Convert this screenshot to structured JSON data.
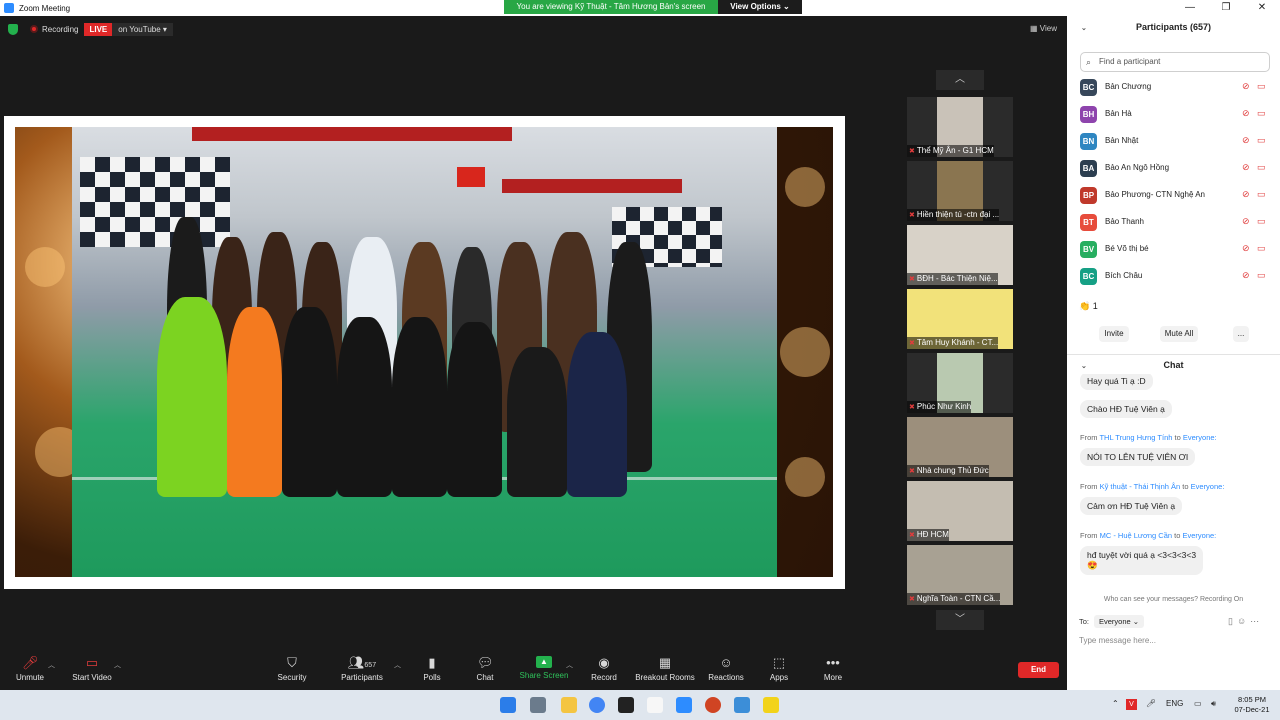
{
  "window": {
    "title": "Zoom Meeting"
  },
  "share_banner": {
    "viewing": "You are viewing Kỹ Thuật - Tâm Hương Bản's screen",
    "view_options": "View Options ⌄"
  },
  "status": {
    "recording": "Recording",
    "live": "LIVE",
    "youtube": "on YouTube ▾",
    "view": "View"
  },
  "thumbnails": [
    {
      "name": "Thể Mỹ Ân - G1 HCM"
    },
    {
      "name": "Hiền thiện tú -ctn đại ..."
    },
    {
      "name": "BĐH - Bác Thiện Niệ..."
    },
    {
      "name": "Tâm Huy Khánh - CT..."
    },
    {
      "name": "Phúc Như Kinh"
    },
    {
      "name": "Nhà chung Thủ Đức"
    },
    {
      "name": "HĐ HCM"
    },
    {
      "name": "Nghĩa Toàn - CTN Cầ..."
    }
  ],
  "toolbar": {
    "unmute": "Unmute",
    "start_video": "Start Video",
    "security": "Security",
    "participants": "Participants",
    "participants_count": "657",
    "polls": "Polls",
    "chat": "Chat",
    "share_screen": "Share Screen",
    "record": "Record",
    "breakout_rooms": "Breakout Rooms",
    "reactions": "Reactions",
    "apps": "Apps",
    "more": "More",
    "end": "End"
  },
  "participants_panel": {
    "title": "Participants (657)",
    "search_placeholder": "Find a participant",
    "items": [
      {
        "initials": "BC",
        "name": "Bản Chương",
        "color": "#37475a"
      },
      {
        "initials": "BH",
        "name": "Bản Hà",
        "color": "#8e44ad"
      },
      {
        "initials": "BN",
        "name": "Bản Nhật",
        "color": "#2e86c1"
      },
      {
        "initials": "BA",
        "name": "Bảo An Ngô Hồng",
        "color": "#2c3e50"
      },
      {
        "initials": "BP",
        "name": "Bảo Phương- CTN Nghệ An",
        "color": "#c0392b"
      },
      {
        "initials": "BT",
        "name": "Bảo Thanh",
        "color": "#e74c3c"
      },
      {
        "initials": "BV",
        "name": "Bé Võ thị bé",
        "color": "#27ae60"
      },
      {
        "initials": "BC",
        "name": "Bích Châu",
        "color": "#16a085"
      }
    ],
    "reaction": "👏 1",
    "invite": "Invite",
    "mute_all": "Mute All",
    "more": "..."
  },
  "chat": {
    "title": "Chat",
    "messages": [
      {
        "from": "",
        "to": "",
        "text": "Hay quá Ti ạ :D"
      },
      {
        "from": "",
        "to": "",
        "text": "Chào HĐ Tuệ Viên ạ"
      },
      {
        "from": "THL Trung Hưng Tính",
        "to": "Everyone:",
        "text": "NÓI TO LÊN TUỆ VIÊN ƠI"
      },
      {
        "from": "Kỹ thuật - Thái Thịnh Ân",
        "to": "Everyone:",
        "text": "Cảm ơn HĐ Tuệ Viên ạ"
      },
      {
        "from": "MC - Huệ Lương Cần",
        "to": "Everyone:",
        "text": "hđ tuyệt vời quá ạ <3<3<3<3"
      }
    ],
    "emoji": "😍",
    "privacy": "Who can see your messages? Recording On",
    "to_label": "To:",
    "to_value": "Everyone ⌄",
    "placeholder": "Type message here..."
  },
  "taskbar": {
    "lang": "ENG",
    "time": "8:05 PM",
    "date": "07-Dec-21"
  }
}
